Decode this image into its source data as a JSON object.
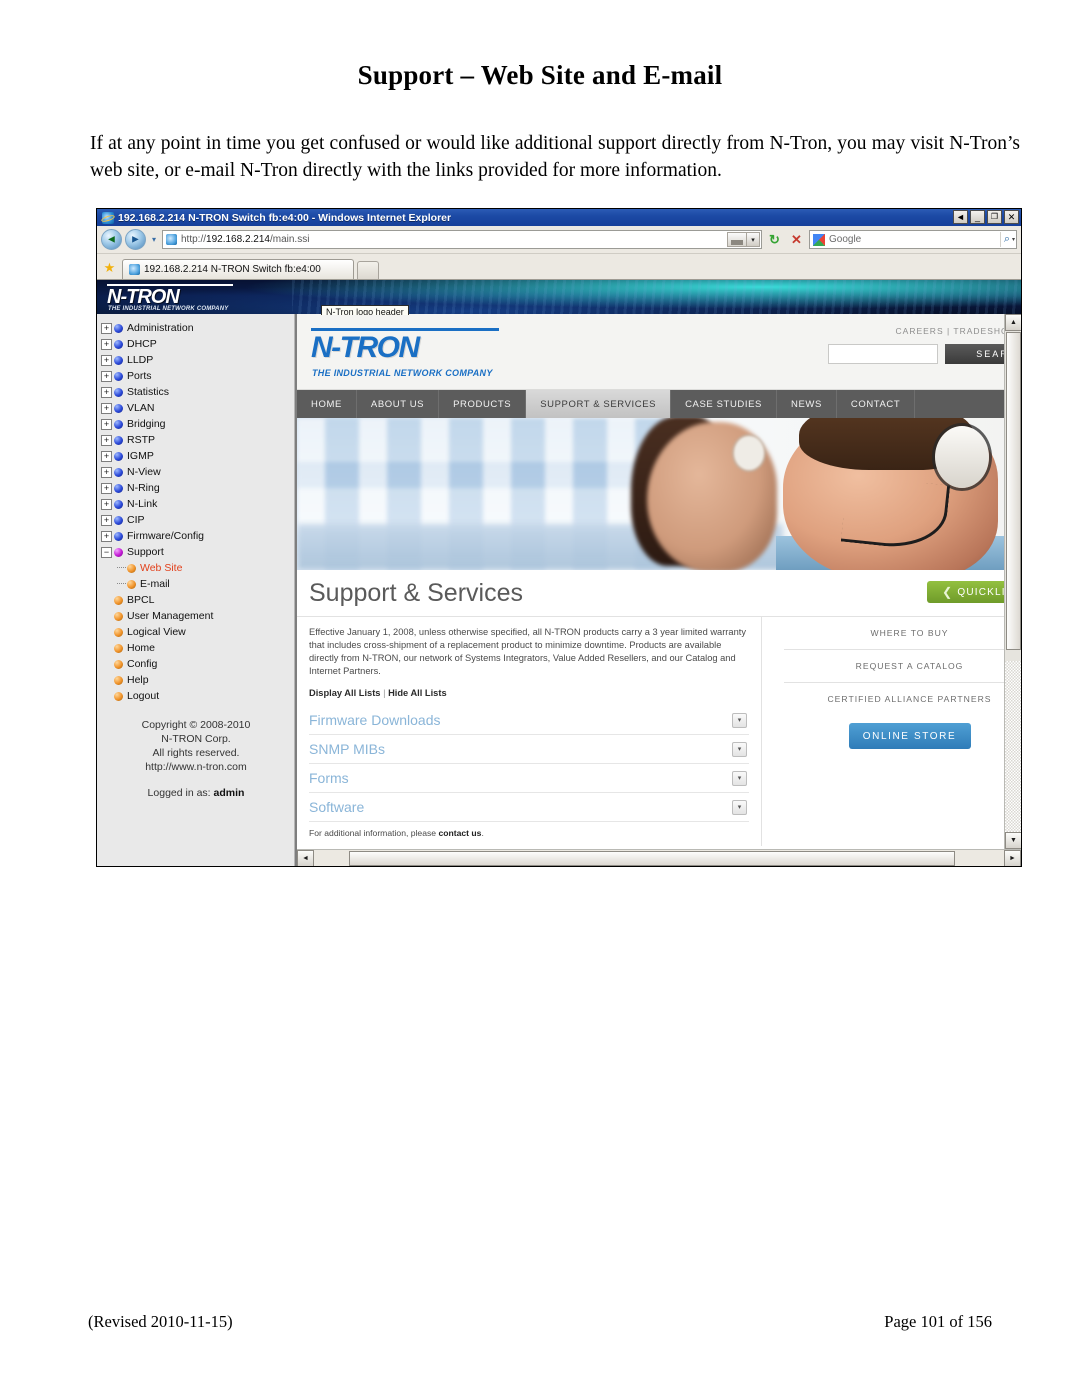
{
  "document": {
    "title": "Support – Web Site and E-mail",
    "paragraph": "If at any point in time you get confused or would like additional support directly from N-Tron, you may visit N-Tron’s web site, or e-mail N-Tron directly with the links provided for more information.",
    "footer_left": "(Revised 2010-11-15)",
    "footer_right": "Page 101 of 156"
  },
  "browser": {
    "window_title": "192.168.2.214 N-TRON Switch fb:e4:00 - Windows Internet Explorer",
    "window_buttons": {
      "restore_left": "◄",
      "minimize": "_",
      "maximize": "❐",
      "close": "✕"
    },
    "nav": {
      "back": "◄",
      "forward": "►",
      "history_dropdown": "▾"
    },
    "address": {
      "url_scheme": "http://",
      "url_host": "192.168.2.214",
      "url_path": "/main.ssi",
      "full": "http://192.168.2.214/main.ssi"
    },
    "toolbar": {
      "refresh": "↻",
      "stop": "✕",
      "compat_dropdown": "▾",
      "search_go": "🔍",
      "search_dropdown": "▾"
    },
    "search": {
      "engine": "Google",
      "placeholder": "Google",
      "value": ""
    },
    "tab": {
      "label": "192.168.2.214 N-TRON Switch fb:e4:00"
    },
    "tooltip": "N-Tron logo header"
  },
  "banner": {
    "logo": "N-TRON",
    "tagline": "THE INDUSTRIAL NETWORK COMPANY"
  },
  "tree": {
    "items": [
      {
        "label": "Administration",
        "expander": "+",
        "bullet": "blue",
        "level": 0
      },
      {
        "label": "DHCP",
        "expander": "+",
        "bullet": "blue",
        "level": 0
      },
      {
        "label": "LLDP",
        "expander": "+",
        "bullet": "blue",
        "level": 0
      },
      {
        "label": "Ports",
        "expander": "+",
        "bullet": "blue",
        "level": 0
      },
      {
        "label": "Statistics",
        "expander": "+",
        "bullet": "blue",
        "level": 0
      },
      {
        "label": "VLAN",
        "expander": "+",
        "bullet": "blue",
        "level": 0
      },
      {
        "label": "Bridging",
        "expander": "+",
        "bullet": "blue",
        "level": 0
      },
      {
        "label": "RSTP",
        "expander": "+",
        "bullet": "blue",
        "level": 0
      },
      {
        "label": "IGMP",
        "expander": "+",
        "bullet": "blue",
        "level": 0
      },
      {
        "label": "N-View",
        "expander": "+",
        "bullet": "blue",
        "level": 0
      },
      {
        "label": "N-Ring",
        "expander": "+",
        "bullet": "blue",
        "level": 0
      },
      {
        "label": "N-Link",
        "expander": "+",
        "bullet": "blue",
        "level": 0
      },
      {
        "label": "CIP",
        "expander": "+",
        "bullet": "blue",
        "level": 0
      },
      {
        "label": "Firmware/Config",
        "expander": "+",
        "bullet": "blue",
        "level": 0
      },
      {
        "label": "Support",
        "expander": "−",
        "bullet": "magenta",
        "level": 0
      },
      {
        "label": "Web Site",
        "expander": "",
        "bullet": "orange",
        "level": 1,
        "active": true
      },
      {
        "label": "E-mail",
        "expander": "",
        "bullet": "orange",
        "level": 1
      },
      {
        "label": "BPCL",
        "expander": "",
        "bullet": "orange",
        "level": 0
      },
      {
        "label": "User Management",
        "expander": "",
        "bullet": "orange",
        "level": 0
      },
      {
        "label": "Logical View",
        "expander": "",
        "bullet": "orange",
        "level": 0
      },
      {
        "label": "Home",
        "expander": "",
        "bullet": "orange",
        "level": 0
      },
      {
        "label": "Config",
        "expander": "",
        "bullet": "orange",
        "level": 0
      },
      {
        "label": "Help",
        "expander": "",
        "bullet": "orange",
        "level": 0
      },
      {
        "label": "Logout",
        "expander": "",
        "bullet": "orange",
        "level": 0
      }
    ],
    "copyright": {
      "line1": "Copyright © 2008-2010",
      "line2": "N-TRON Corp.",
      "line3": "All rights reserved.",
      "line4": "http://www.n-tron.com"
    },
    "logged_in_prefix": "Logged in as: ",
    "logged_in_user": "admin"
  },
  "site": {
    "logo": "N-TRON",
    "tagline": "THE INDUSTRIAL NETWORK COMPANY",
    "toplinks": "CAREERS | TRADESHOWS | CO",
    "search_value": "",
    "search_button": "SEARCH",
    "nav": [
      {
        "label": "HOME",
        "active": false
      },
      {
        "label": "ABOUT US",
        "active": false
      },
      {
        "label": "PRODUCTS",
        "active": false
      },
      {
        "label": "SUPPORT & SERVICES",
        "active": true
      },
      {
        "label": "CASE STUDIES",
        "active": false
      },
      {
        "label": "NEWS",
        "active": false
      },
      {
        "label": "CONTACT",
        "active": false
      }
    ],
    "heading": "Support & Services",
    "intro": "Effective January 1, 2008, unless otherwise specified, all N-TRON products carry a 3 year limited warranty that includes cross-shipment of a replacement product to minimize downtime. Products are available directly from N-TRON, our network of Systems Integrators, Value Added Resellers, and our Catalog and Internet Partners.",
    "display_all": "Display All Lists",
    "hide_all": "Hide All Lists",
    "list_separator": " | ",
    "accordions": [
      {
        "label": "Firmware Downloads",
        "toggle": "▾"
      },
      {
        "label": "SNMP MIBs",
        "toggle": "▾"
      },
      {
        "label": "Forms",
        "toggle": "▾"
      },
      {
        "label": "Software",
        "toggle": "▾"
      }
    ],
    "contact_prefix": "For additional information, please ",
    "contact_link": "contact us",
    "contact_suffix": ".",
    "quicklinks": {
      "label": "QUICKLINKS",
      "chevron": "❮"
    },
    "side_links": [
      "WHERE TO BUY",
      "REQUEST A CATALOG",
      "CERTIFIED ALLIANCE PARTNERS"
    ],
    "online_store": "ONLINE STORE"
  },
  "colors": {
    "titlebar_blue": "#1c4aa5",
    "ntron_blue": "#1a6fc4",
    "active_tree_item": "#e2401b",
    "quicklinks_green": "#7fae33",
    "online_store_blue": "#3f8cc6",
    "accordion_link": "#8ab5d8"
  }
}
